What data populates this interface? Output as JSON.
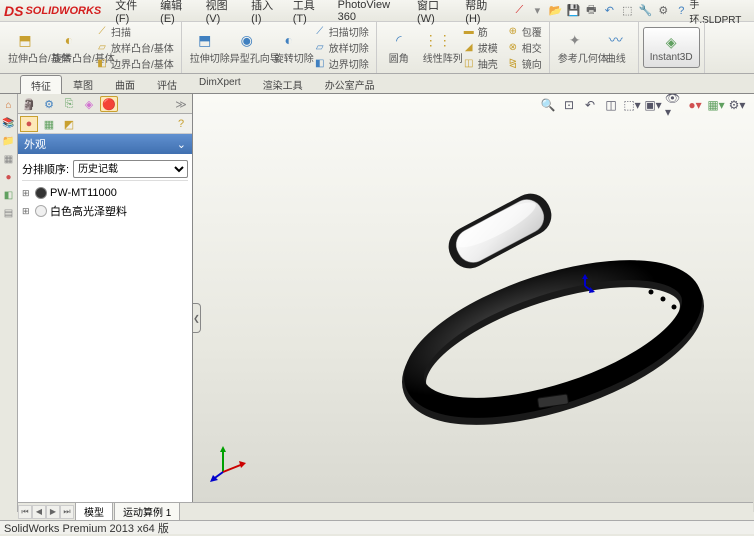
{
  "app": {
    "name": "SOLIDWORKS",
    "doc_title": "手环.SLDPRT"
  },
  "menu": {
    "file": "文件(F)",
    "edit": "编辑(E)",
    "view": "视图(V)",
    "insert": "插入(I)",
    "tools": "工具(T)",
    "photoview": "PhotoView 360",
    "window": "窗口(W)",
    "help": "帮助(H)"
  },
  "ribbon": {
    "extrude": "拉伸凸台/基体",
    "revolve": "旋转凸台/基体",
    "sweep": "扫描",
    "loft": "放样凸台/基体",
    "boundary": "边界凸台/基体",
    "ext_cut": "拉伸切除",
    "hole": "异型孔向导",
    "rev_cut": "旋转切除",
    "sweep_cut": "扫描切除",
    "loft_cut": "放样切除",
    "bound_cut": "边界切除",
    "fillet": "圆角",
    "linear": "线性阵列",
    "rib": "筋",
    "draft": "拔模",
    "shell": "抽壳",
    "wrap": "包覆",
    "intersect": "相交",
    "mirror": "镜向",
    "refgeom": "参考几何体",
    "curves": "曲线",
    "instant3d": "Instant3D"
  },
  "tabs": {
    "features": "特征",
    "sketch": "草图",
    "surfaces": "曲面",
    "evaluate": "评估",
    "dimxpert": "DimXpert",
    "render": "渲染工具",
    "office": "办公室产品"
  },
  "panel": {
    "title": "外观",
    "sort_label": "分排顺序:",
    "sort_value": "历史记载",
    "items": [
      {
        "name": "PW-MT11000",
        "color": "#333333"
      },
      {
        "name": "白色高光泽塑料",
        "color": "#f0f0f0"
      }
    ]
  },
  "bottom": {
    "model": "模型",
    "motion": "运动算例 1"
  },
  "status": {
    "text": "SolidWorks Premium 2013 x64 版"
  }
}
